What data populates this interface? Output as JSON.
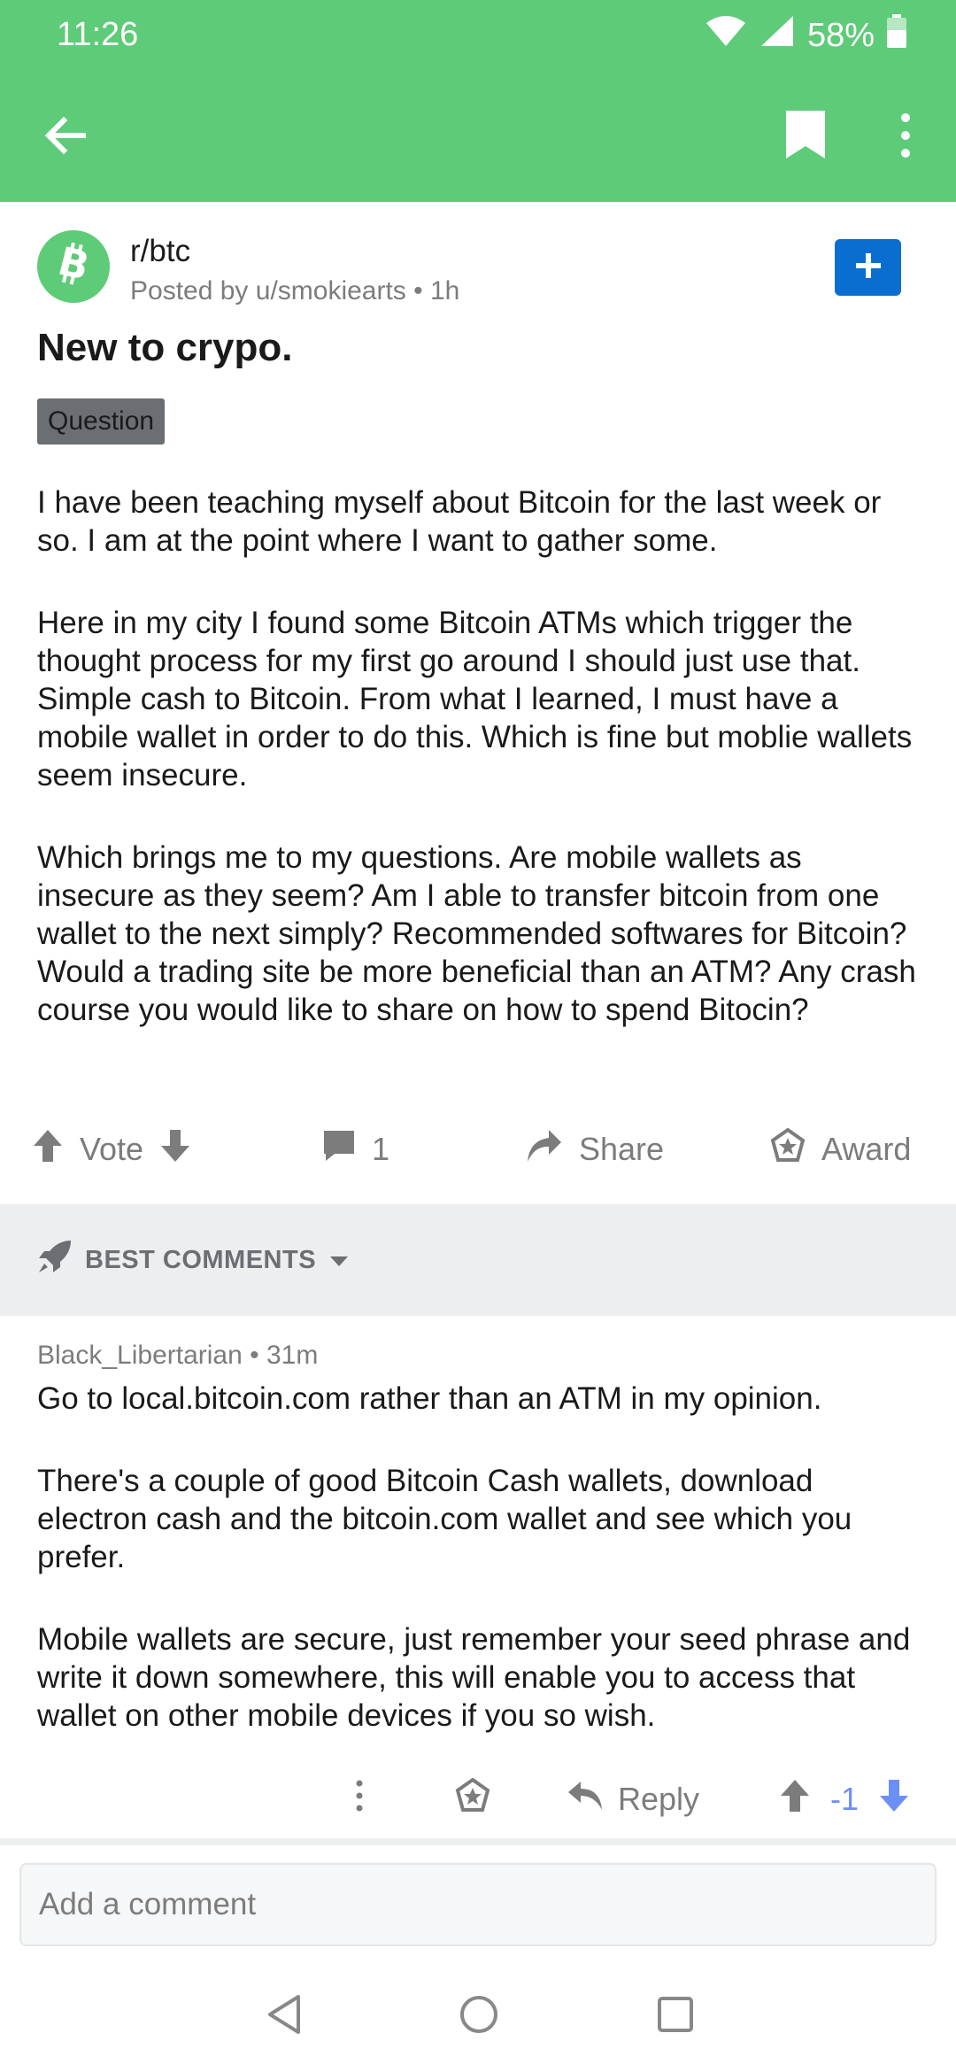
{
  "status_bar": {
    "time": "11:26",
    "battery": "58%"
  },
  "header": {
    "back_icon": "arrow-left-icon",
    "bookmark_icon": "bookmark-icon",
    "more_icon": "more-vertical-icon"
  },
  "post": {
    "subreddit": "r/btc",
    "posted_by": "Posted by u/smokiearts • 1h",
    "title": "New to crypo.",
    "flair": "Question",
    "body": [
      "I have been teaching myself about Bitcoin for the last week or so. I am at the point where I want to gather some.",
      "Here in my city I found some Bitcoin ATMs which trigger the thought process for my first go around I should just use that. Simple cash to Bitcoin. From what I learned, I must have a mobile wallet in order to do this. Which is fine but moblie wallets seem insecure.",
      "Which brings me to my questions. Are mobile wallets as insecure as they seem? Am I able to transfer bitcoin from one wallet to the next simply? Recommended softwares for Bitcoin? Would a trading site be more beneficial than an ATM? Any crash course you would like to share on how to spend Bitocin?"
    ],
    "actions": {
      "vote": "Vote",
      "comments": "1",
      "share": "Share",
      "award": "Award"
    }
  },
  "sort": {
    "label": "BEST COMMENTS"
  },
  "comment": {
    "author_meta": "Black_Libertarian • 31m",
    "body": [
      "Go to local.bitcoin.com rather than an ATM in my opinion.",
      "There's a couple of good Bitcoin Cash wallets, download electron cash and the bitcoin.com wallet and see which you prefer.",
      "Mobile wallets are secure, just remember your seed phrase and write it down somewhere, this will enable you to access that wallet on other mobile devices if you so wish."
    ],
    "reply": "Reply",
    "score": "-1"
  },
  "add_comment": {
    "placeholder": "Add a comment"
  },
  "colors": {
    "header_green": "#5ecb78",
    "join_blue": "#0a6ed1",
    "score_blue": "#6b8ff5"
  }
}
